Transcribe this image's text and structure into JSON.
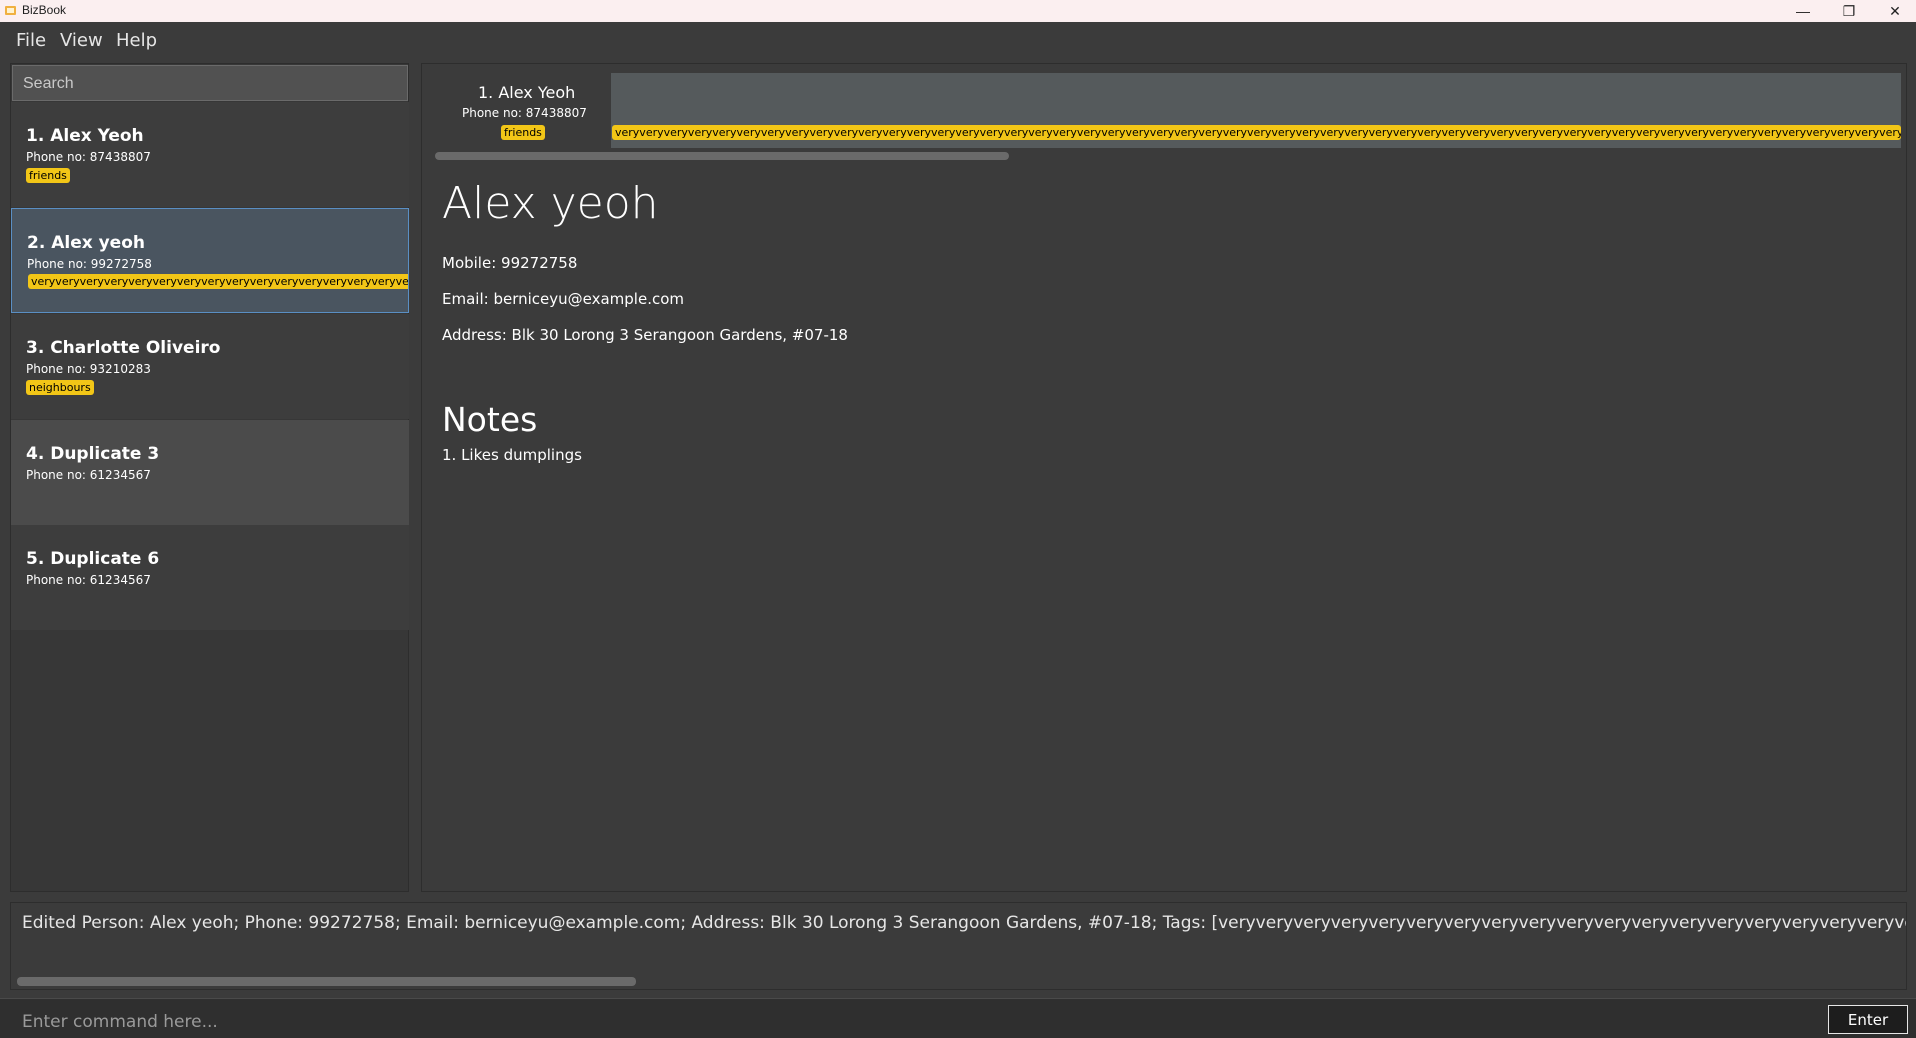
{
  "window": {
    "title": "BizBook",
    "minimize_glyph": "—",
    "restore_glyph": "❐",
    "close_glyph": "✕"
  },
  "menu": {
    "file": "File",
    "view": "View",
    "help": "Help"
  },
  "search": {
    "placeholder": "Search"
  },
  "contacts": [
    {
      "name": "1. Alex Yeoh",
      "phone": "Phone no: 87438807",
      "tag": "friends"
    },
    {
      "name": "2. Alex yeoh",
      "phone": "Phone no: 99272758",
      "tag": "veryveryveryveryveryveryveryveryveryveryveryveryveryveryveryveryveryveryveryveryvery"
    },
    {
      "name": "3. Charlotte Oliveiro",
      "phone": "Phone no: 93210283",
      "tag": "neighbours"
    },
    {
      "name": "4. Duplicate 3",
      "phone": "Phone no: 61234567"
    },
    {
      "name": "5. Duplicate 6",
      "phone": "Phone no: 61234567"
    }
  ],
  "mini_card": {
    "name": "1. Alex Yeoh",
    "phone": "Phone no: 87438807",
    "tag": "friends",
    "long_tag": "veryveryveryveryveryveryveryveryveryveryveryveryveryveryveryveryveryveryveryveryveryveryveryveryveryveryveryveryveryveryveryveryveryveryveryveryveryveryveryveryveryveryveryveryveryveryveryveryveryveryveryveryveryveryveryveryveryveryveryveryveryveryveryveryveryvery"
  },
  "detail": {
    "name": "Alex yeoh",
    "mobile": "Mobile: 99272758",
    "email": "Email: berniceyu@example.com",
    "address": "Address: Blk 30 Lorong 3 Serangoon Gardens, #07-18",
    "notes_title": "Notes",
    "notes": [
      "1. Likes dumplings"
    ]
  },
  "result": {
    "text": "Edited Person: Alex yeoh; Phone: 99272758; Email: berniceyu@example.com; Address: Blk 30 Lorong 3 Serangoon Gardens, #07-18; Tags: [veryveryveryveryveryveryveryveryveryveryveryveryveryveryveryveryveryveryveryveryveryveryveryveryveryveryveryvery"
  },
  "command": {
    "placeholder": "Enter command here...",
    "enter_label": "Enter"
  },
  "colors": {
    "tag": "#f2c617",
    "selected_card": "#4a5560",
    "selected_border": "#5a8fc4",
    "card_alt": "#4b4b4b",
    "card_default": "#3d3d3d"
  }
}
